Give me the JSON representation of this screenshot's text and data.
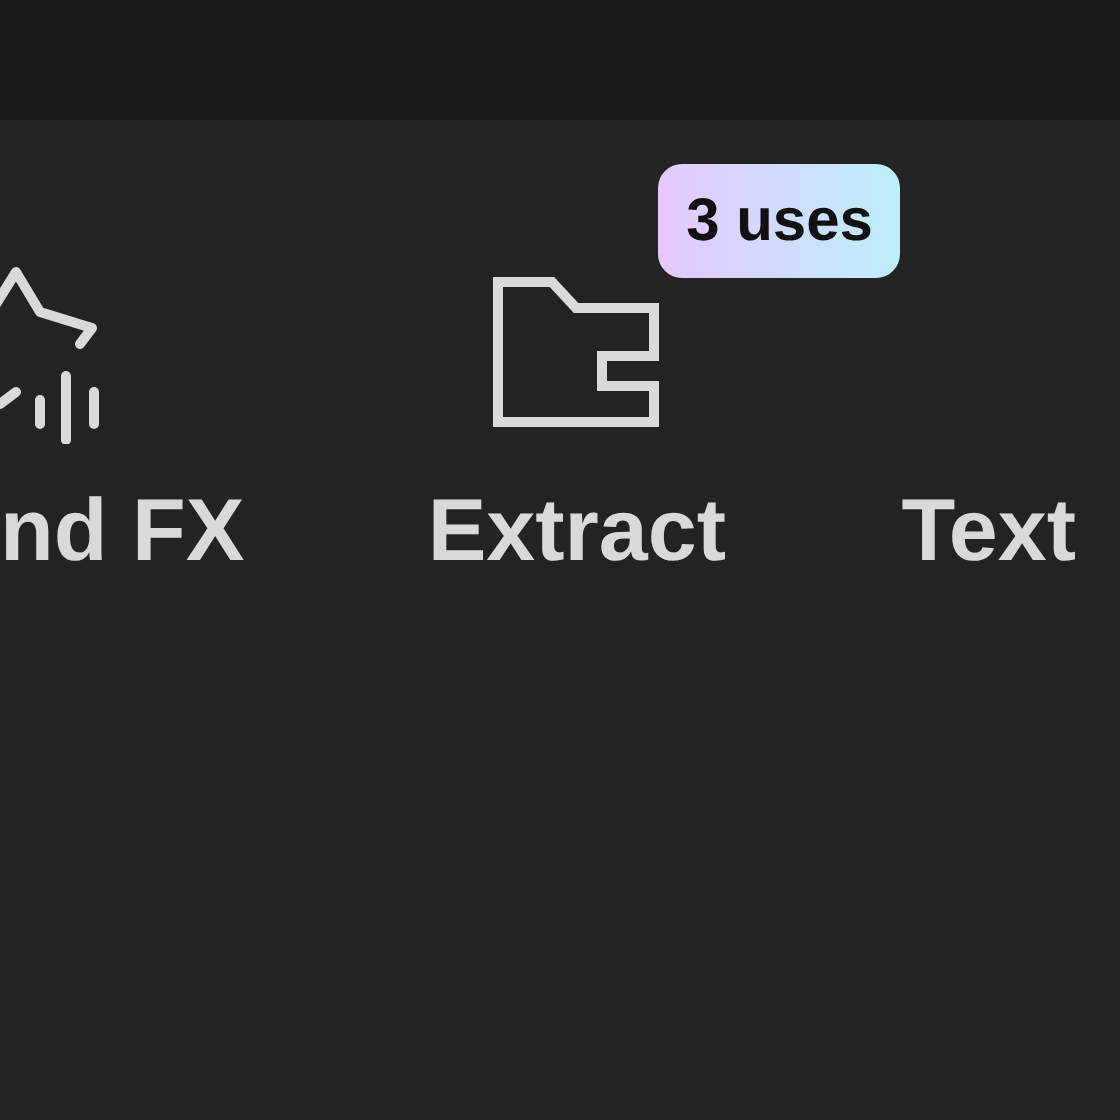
{
  "tools": [
    {
      "kind": "sound-fx",
      "label": "nd FX"
    },
    {
      "kind": "extract",
      "label": "Extract",
      "badge": "3 uses"
    },
    {
      "kind": "text",
      "label": "Text"
    }
  ]
}
